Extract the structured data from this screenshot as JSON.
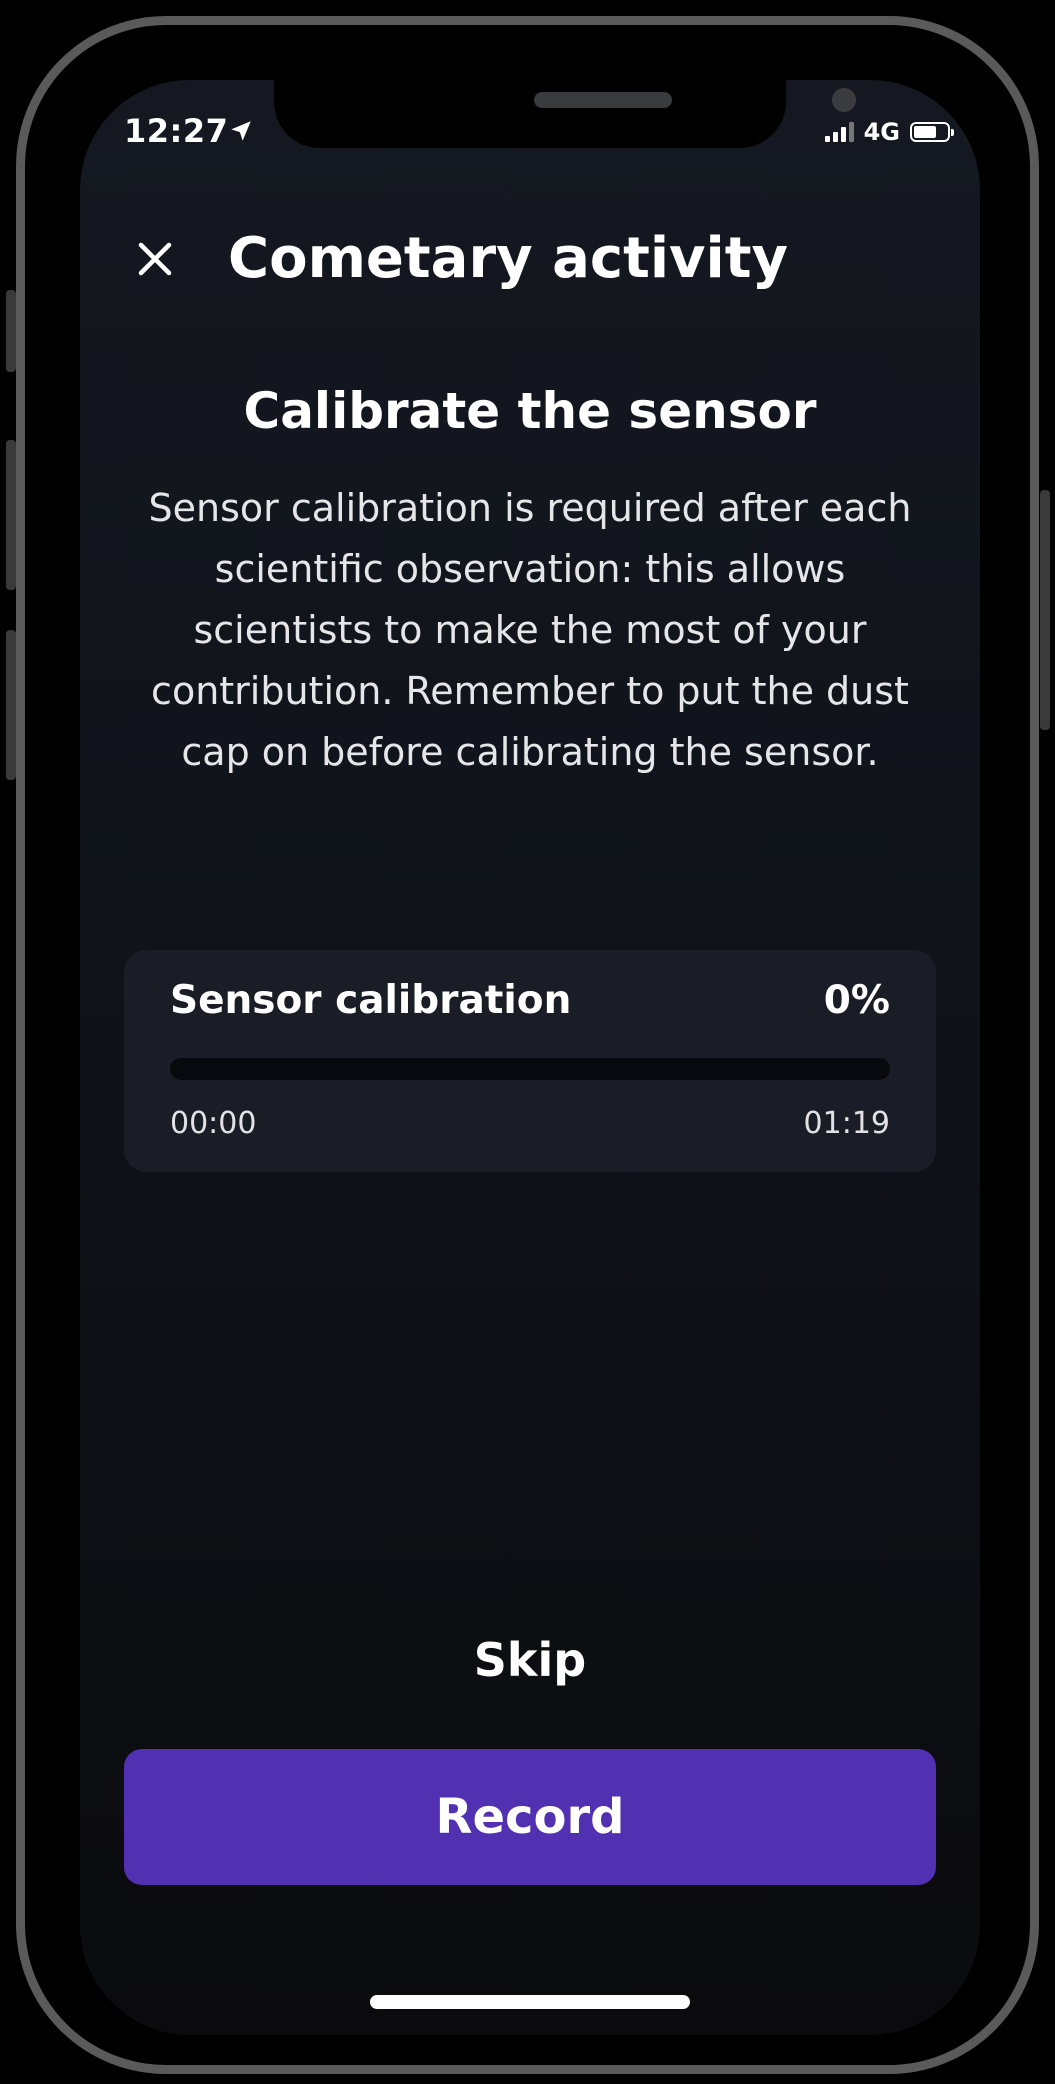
{
  "status_bar": {
    "time": "12:27",
    "network": "4G",
    "icons": [
      "location-arrow-icon",
      "signal-icon",
      "battery-icon"
    ]
  },
  "header": {
    "title": "Cometary activity",
    "close_icon": "close-icon"
  },
  "section": {
    "title": "Calibrate the sensor",
    "description": "Sensor calibration is required after each scientific observation: this allows scientists to make the most of your contribution. Remember to put the dust cap on before calibrating the sensor."
  },
  "calibration": {
    "label": "Sensor calibration",
    "percent_text": "0%",
    "progress": 0,
    "elapsed": "00:00",
    "total": "01:19"
  },
  "actions": {
    "skip_label": "Skip",
    "record_label": "Record"
  },
  "colors": {
    "accent": "#5230b2",
    "background": "#10131a",
    "card": "#1a1d25"
  }
}
